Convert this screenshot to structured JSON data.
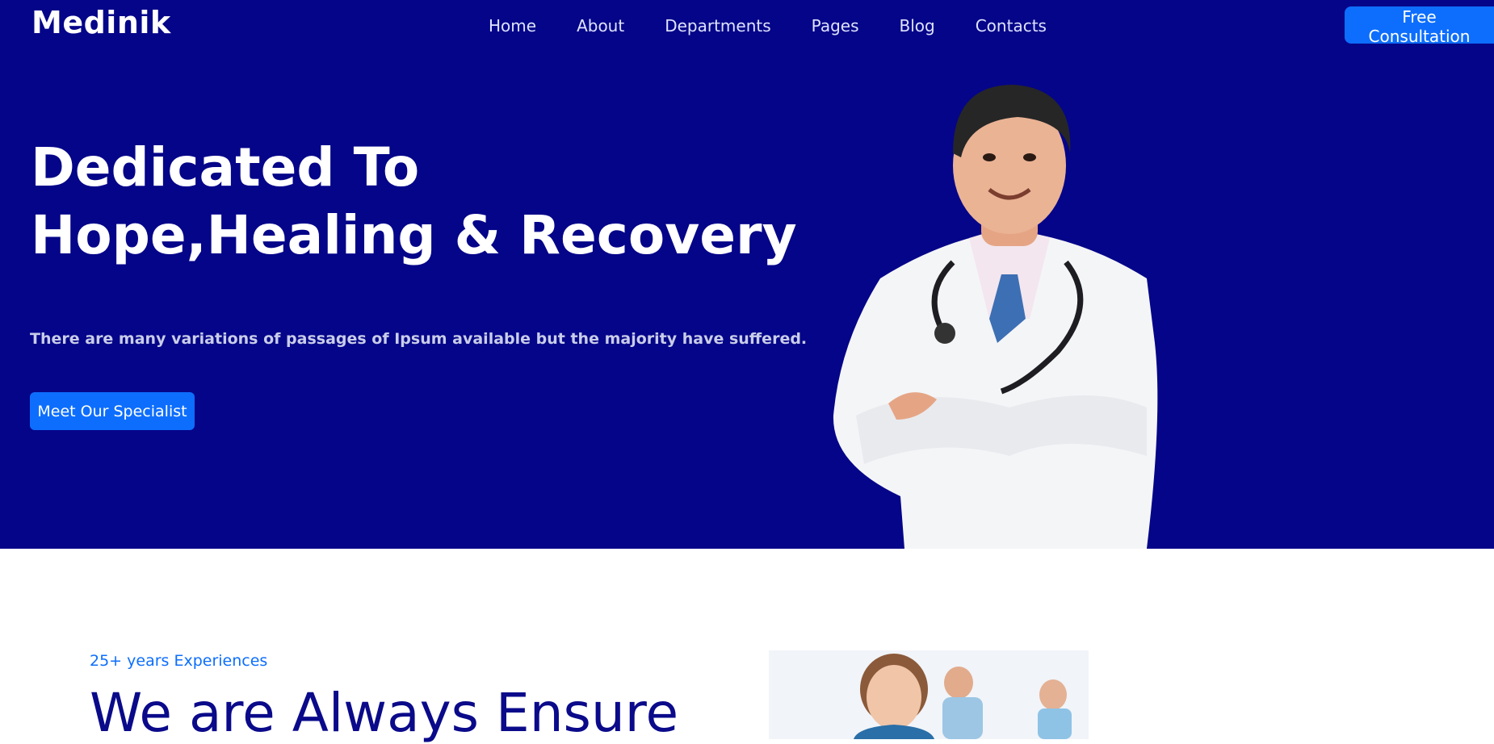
{
  "brand": "Medinik",
  "nav": {
    "items": [
      "Home",
      "About",
      "Departments",
      "Pages",
      "Blog",
      "Contacts"
    ],
    "cta_label": "Free Consultation"
  },
  "hero": {
    "headline_line1": "Dedicated To",
    "headline_line2": "Hope,Healing & Recovery",
    "subtext": "There are many variations of passages of Ipsum available but the majority have suffered.",
    "button_label": "Meet Our Specialist"
  },
  "about": {
    "eyebrow": "25+ years Experiences",
    "title": "We are Always Ensure"
  },
  "colors": {
    "hero_bg": "#050589",
    "accent": "#0d6efd",
    "title_navy": "#0a0a8a"
  }
}
